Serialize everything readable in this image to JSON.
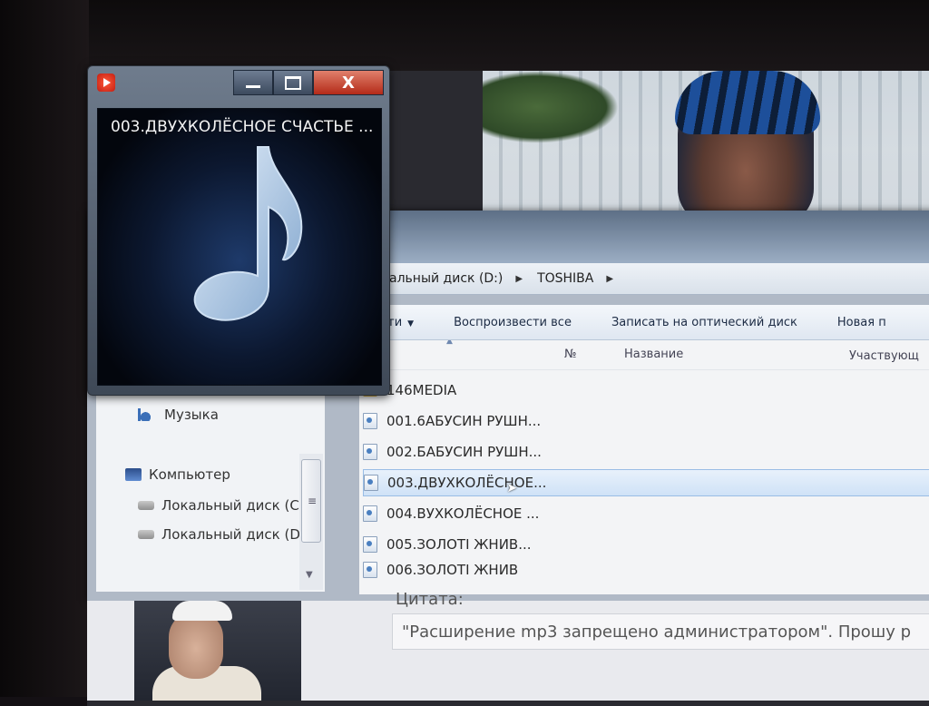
{
  "player": {
    "track_title": "003.ДВУХКОЛЁСНОЕ СЧАСТЬЕ ...",
    "close_label": "X",
    "icons": [
      "windows-media-player-icon",
      "minimize-icon",
      "maximize-icon",
      "close-icon",
      "music-note-icon"
    ]
  },
  "explorer": {
    "breadcrumb": [
      {
        "label": "окальный диск (D:)"
      },
      {
        "label": "TOSHIBA"
      }
    ],
    "toolbar": {
      "organize_partial": "сти",
      "play_all": "Воспроизвести все",
      "burn": "Записать на оптический диск",
      "new_partial": "Новая п"
    },
    "columns": {
      "number": "№",
      "name": "Название",
      "artist": "Участвующ"
    },
    "files": [
      {
        "name": "146MEDIA",
        "kind": "folder"
      },
      {
        "name": "001.6АБУСИН РУШН...",
        "kind": "audio"
      },
      {
        "name": "002.БАБУСИН РУШН...",
        "kind": "audio"
      },
      {
        "name": "003.ДВУХКОЛЁСНОЕ...",
        "kind": "audio",
        "selected": true
      },
      {
        "name": "004.ВУХКОЛЁСНОЕ ...",
        "kind": "audio"
      },
      {
        "name": "005.ЗОЛОТI  ЖНИВ...",
        "kind": "audio"
      },
      {
        "name": "006.ЗОЛОТI  ЖНИВ",
        "kind": "audio"
      }
    ],
    "nav": {
      "music": "Музыка",
      "computer": "Компьютер",
      "disk_c": "Локальный диск (С",
      "disk_d": "Локальный диск (D"
    }
  },
  "forum": {
    "quote_label": "Цитата:",
    "quote_text": "\"Расширение mp3 запрещено администратором\". Прошу р"
  }
}
